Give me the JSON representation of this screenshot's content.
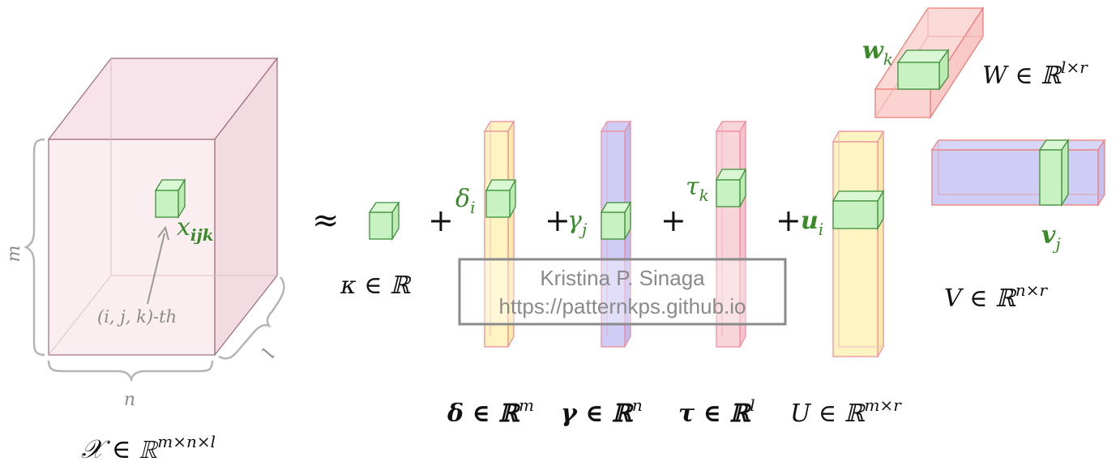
{
  "tensor": {
    "label_main": "𝒳 ∈ ℝ",
    "label_sup": "m×n×l",
    "dim_m": "m",
    "dim_n": "n",
    "dim_l": "l",
    "element_label": "x",
    "element_sub": "ijk",
    "index_label": "(i, j, k)-th"
  },
  "approx_symbol": "≈",
  "plus_symbol": "+",
  "kappa": {
    "label": "κ ∈ ℝ"
  },
  "delta": {
    "symbol": "δ",
    "sub": "i",
    "label": "δ ∈ ℝ",
    "sup": "m"
  },
  "gamma": {
    "symbol": "γ",
    "sub": "j",
    "label": "γ ∈ ℝ",
    "sup": "n"
  },
  "tau": {
    "symbol": "τ",
    "sub": "k",
    "label": "τ ∈ ℝ",
    "sup": "l"
  },
  "U": {
    "symbol": "u",
    "sub": "i",
    "label": "U ∈ ℝ",
    "sup": "m×r"
  },
  "W": {
    "symbol": "w",
    "sub": "k",
    "label": "W ∈ ℝ",
    "sup": "l×r"
  },
  "V": {
    "symbol": "v",
    "sub": "j",
    "label": "V ∈ ℝ",
    "sup": "n×r"
  },
  "watermark": {
    "line1": "Kristina P. Sinaga",
    "line2": "https://patternkps.github.io"
  },
  "colors": {
    "cube_fill": "#fbeef1",
    "cube_stroke": "#9a6a7c",
    "green_fill": "#c9f2c3",
    "green_stroke": "#3d8f3a",
    "yellow_fill": "#fdf4c2",
    "blue_fill": "#cfcdf5",
    "red_fill": "#f8d5da",
    "pink_stroke": "#ee8898",
    "salmon_fill": "#fbd4d2",
    "salmon_stroke": "#ee7f78"
  }
}
